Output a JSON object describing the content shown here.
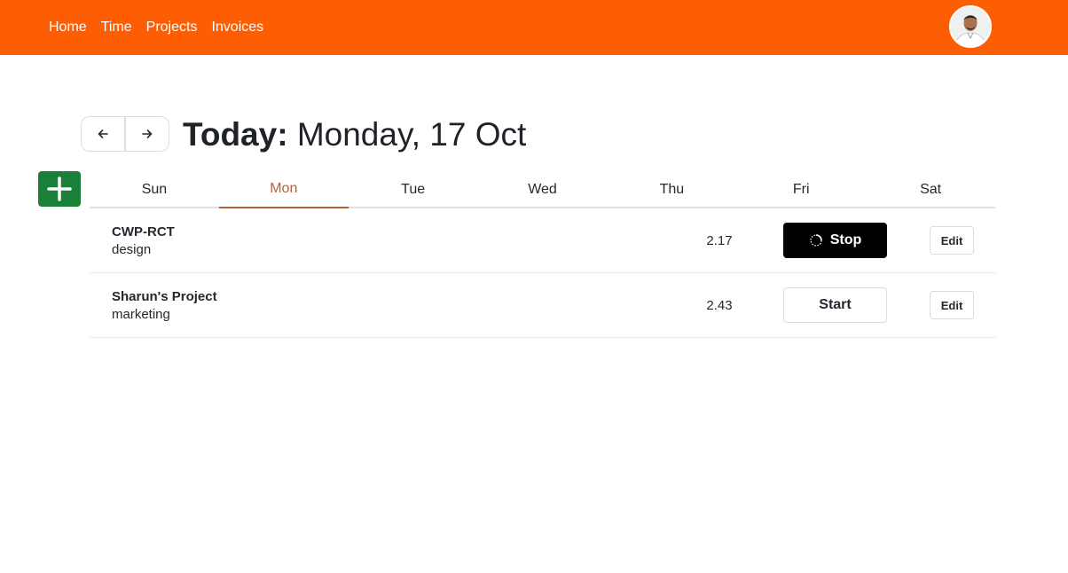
{
  "nav": {
    "items": [
      {
        "label": "Home"
      },
      {
        "label": "Time"
      },
      {
        "label": "Projects"
      },
      {
        "label": "Invoices"
      }
    ]
  },
  "user": {
    "avatar_icon": "user-avatar"
  },
  "header": {
    "title_bold": "Today:",
    "title_date": "Monday, 17 Oct"
  },
  "week": {
    "days": [
      "Sun",
      "Mon",
      "Tue",
      "Wed",
      "Thu",
      "Fri",
      "Sat"
    ],
    "active": "Mon"
  },
  "entries": [
    {
      "project": "CWP-RCT",
      "task": "design",
      "hours": "2.17",
      "action": "Stop",
      "running": true,
      "edit": "Edit"
    },
    {
      "project": "Sharun's Project",
      "task": "marketing",
      "hours": "2.43",
      "action": "Start",
      "running": false,
      "edit": "Edit"
    }
  ],
  "colors": {
    "brand": "#fd5e03",
    "add_button": "#1a7f37",
    "active_tab": "#b0623a"
  }
}
